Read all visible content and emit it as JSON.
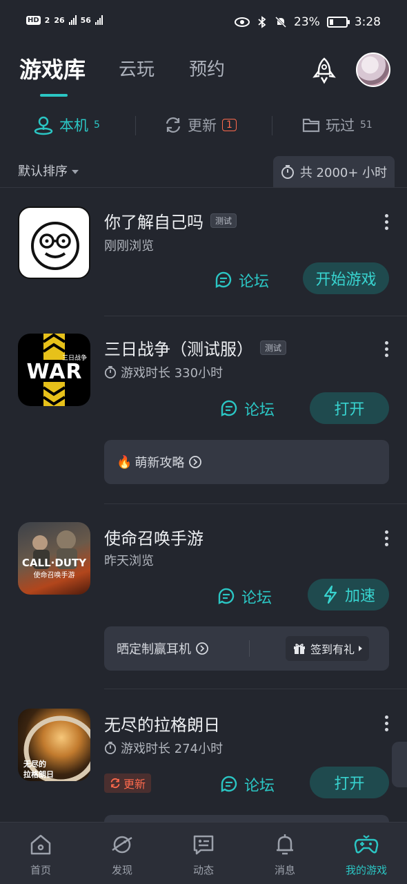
{
  "status": {
    "network_label": "HD",
    "network_sub": "2",
    "sig1": "26",
    "sig2": "56",
    "battery_pct": "23%",
    "time": "3:28",
    "battery_level": 0.23
  },
  "topnav": {
    "tabs": [
      {
        "label": "游戏库",
        "active": true
      },
      {
        "label": "云玩",
        "active": false
      },
      {
        "label": "预约",
        "active": false
      }
    ],
    "rocket_icon": "rocket-icon",
    "avatar_icon": "avatar"
  },
  "subtabs": [
    {
      "label": "本机",
      "count": "5",
      "icon": "location-icon"
    },
    {
      "label": "更新",
      "count": "1",
      "icon": "refresh-icon"
    },
    {
      "label": "玩过",
      "count": "51",
      "icon": "folder-icon"
    }
  ],
  "sort": {
    "label": "默认排序",
    "hours": "共 2000+ 小时"
  },
  "games": [
    {
      "title": "你了解自己吗",
      "tag": "测试",
      "sub": "刚刚浏览",
      "forum": "论坛",
      "action": "开始游戏"
    },
    {
      "title": "三日战争（测试服）",
      "tag": "测试",
      "sub": "游戏时长 330小时",
      "forum": "论坛",
      "action": "打开",
      "extra": "萌新攻略",
      "icon_text": "三日战争",
      "icon_war": "WAR"
    },
    {
      "title": "使命召唤手游",
      "sub": "昨天浏览",
      "forum": "论坛",
      "action": "加速",
      "extra": "晒定制赢耳机",
      "extra_right": "签到有礼",
      "icon_text1": "CALL·DUTY",
      "icon_text2": "使命召唤手游"
    },
    {
      "title": "无尽的拉格朗日",
      "sub": "游戏时长 274小时",
      "forum": "论坛",
      "action": "打开",
      "update_badge": "更新",
      "icon_text1": "无尽的",
      "icon_text2": "拉格朗日"
    }
  ],
  "bottomnav": [
    {
      "label": "首页",
      "icon": "home-icon"
    },
    {
      "label": "发现",
      "icon": "planet-icon"
    },
    {
      "label": "动态",
      "icon": "message-icon"
    },
    {
      "label": "消息",
      "icon": "bell-icon"
    },
    {
      "label": "我的游戏",
      "icon": "gamepad-icon",
      "active": true
    }
  ],
  "colors": {
    "accent": "#2bc6c4",
    "background": "#23262e",
    "alert": "#ff6a4d"
  }
}
